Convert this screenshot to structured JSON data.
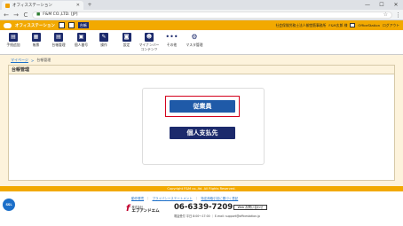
{
  "browser": {
    "tab_title": "オフィスステーション",
    "tab_close": "✕",
    "new_tab": "+",
    "window_controls": [
      "—",
      "☐",
      "✕"
    ],
    "nav_back": "←",
    "nav_forward": "→",
    "nav_reload": "C",
    "secure_label": "F&M CO.,LTD. [JP]",
    "star": "☆",
    "menu": "⋮"
  },
  "app_header": {
    "logo_text": "オフィスステーション",
    "plan_badge": "台帳",
    "right_links": [
      "社会保険労務士法人御堂筋事務所",
      "F&M太郎 様",
      "OfficeStation",
      "ログアウト"
    ]
  },
  "icon_menu": {
    "items": [
      {
        "label": "手続追加",
        "icon": "doc-plus-icon",
        "glyph": "▤"
      },
      {
        "label": "帳票",
        "icon": "report-icon",
        "glyph": "▦"
      },
      {
        "label": "台帳管理",
        "icon": "ledger-icon",
        "glyph": "▤"
      },
      {
        "label": "個人番号",
        "icon": "id-card-icon",
        "glyph": "▣"
      },
      {
        "label": "操作",
        "icon": "operation-icon",
        "glyph": "✎"
      },
      {
        "label": "設定",
        "icon": "camera-icon",
        "glyph": "◙"
      },
      {
        "label": "マイナンバー\nコンテンツ",
        "icon": "people-icon",
        "glyph": "☻"
      },
      {
        "label": "その他",
        "icon": "more-icon",
        "glyph": "•••"
      },
      {
        "label": "マスタ管理",
        "icon": "gear-icon",
        "glyph": "⚙"
      }
    ]
  },
  "breadcrumb": {
    "home": "マイページ",
    "separator": ">",
    "current": "台帳管理"
  },
  "page": {
    "title": "台帳管理",
    "employee_button": "従業員",
    "individual_payee_button": "個人支払先"
  },
  "footer": {
    "copyright": "Copyright F&M co.,ltd. All Rights Reserved.",
    "round_badge": "SSL",
    "links": [
      "動作環境",
      "プライバシーステートメント",
      "特定商取引法に基づく表記"
    ],
    "link_separator": "｜",
    "company_small": "株式会社",
    "company_name": "エフアンドエム",
    "phone": "06-6339-7209",
    "web_box": "Web お問い合わせ",
    "hours": "電話受付 平日 8:00～17:00 ｜ E-mail: support@officestation.jp"
  },
  "colors": {
    "brand_orange": "#f2a900",
    "navy": "#1c2a6c",
    "highlight_red": "#d4001c",
    "content_bg": "#fdf3dc"
  }
}
